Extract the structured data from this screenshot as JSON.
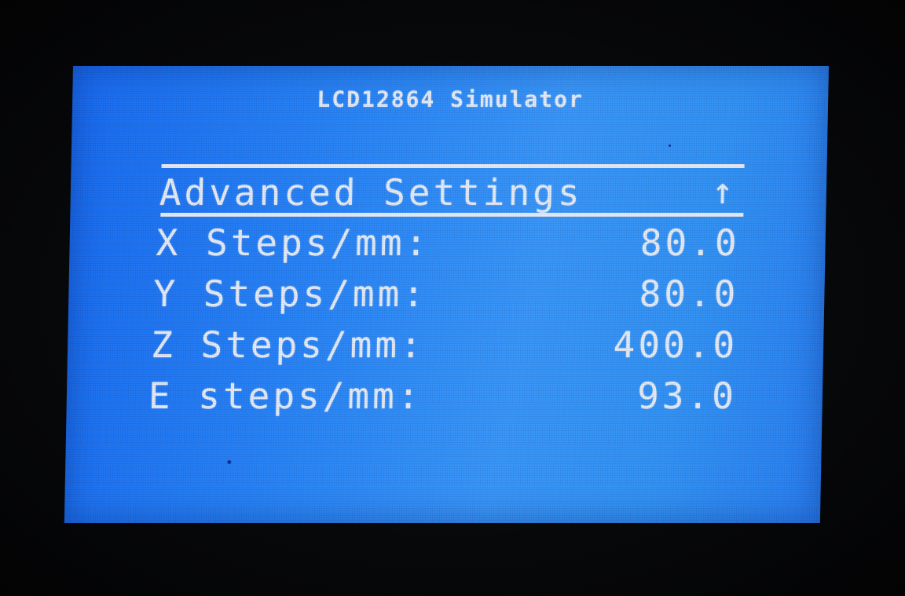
{
  "simulator": {
    "title": "LCD12864 Simulator"
  },
  "menu": {
    "title": "Advanced Settings",
    "scroll_icon": "up-arrow-icon",
    "scroll_glyph": "↑",
    "items": [
      {
        "label": "X Steps/mm:",
        "value": "80.0"
      },
      {
        "label": "Y Steps/mm:",
        "value": "80.0"
      },
      {
        "label": "Z Steps/mm:",
        "value": "400.0"
      },
      {
        "label": "E steps/mm:",
        "value": "93.0"
      }
    ]
  },
  "colors": {
    "screen_blue": "#2a86f6",
    "pixel_white": "#e6ecf6",
    "bezel": "#07080a"
  }
}
